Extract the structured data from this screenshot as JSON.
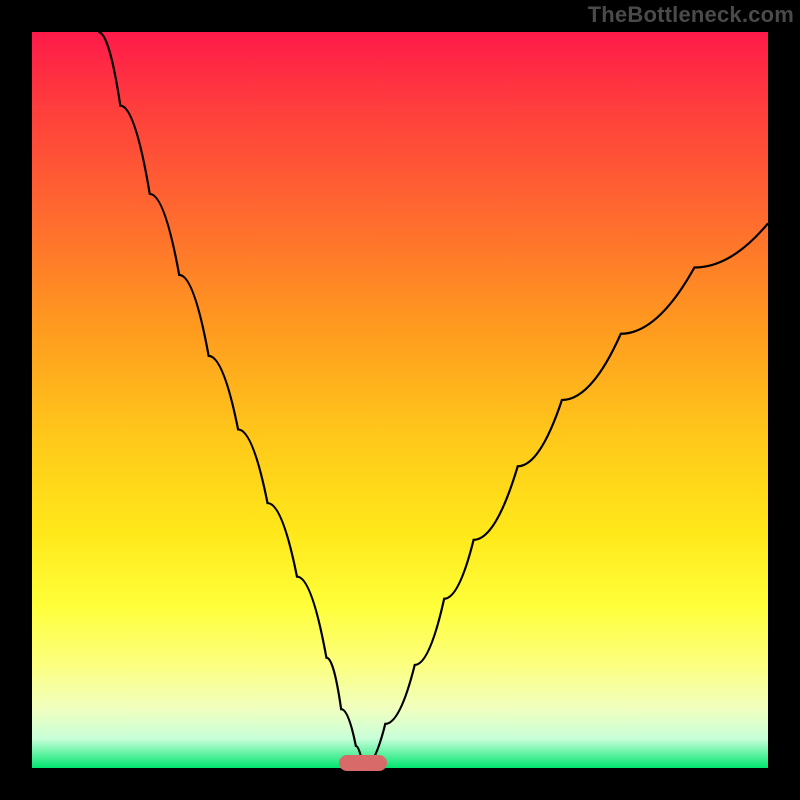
{
  "watermark": "TheBottleneck.com",
  "chart_data": {
    "type": "line",
    "title": "",
    "xlabel": "",
    "ylabel": "",
    "xlim": [
      0,
      100
    ],
    "ylim": [
      0,
      100
    ],
    "grid": false,
    "series": [
      {
        "name": "curve",
        "x": [
          9,
          12,
          16,
          20,
          24,
          28,
          32,
          36,
          40,
          42,
          44,
          45,
          48,
          52,
          56,
          60,
          66,
          72,
          80,
          90,
          100
        ],
        "y": [
          100,
          90,
          78,
          67,
          56,
          46,
          36,
          26,
          15,
          8,
          3,
          0,
          6,
          14,
          23,
          31,
          41,
          50,
          59,
          68,
          74
        ]
      }
    ],
    "marker": {
      "x": 45,
      "color": "#d86a6a"
    },
    "gradient_stops": [
      {
        "pos": 0,
        "color": "#ff1a4a"
      },
      {
        "pos": 100,
        "color": "#00e56f"
      }
    ]
  }
}
